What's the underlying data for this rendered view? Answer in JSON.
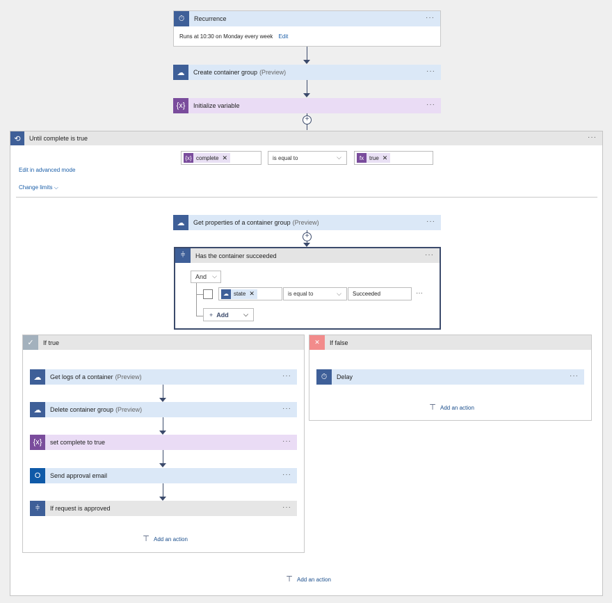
{
  "recurrence": {
    "title": "Recurrence",
    "summary": "Runs at 10:30 on Monday every week",
    "edit": "Edit",
    "icon": "clock-icon"
  },
  "create_group": {
    "title": "Create container group",
    "tag": "(Preview)",
    "icon": "container-cloud-icon"
  },
  "init_var": {
    "title": "Initialize variable",
    "icon": "variable-icon"
  },
  "until": {
    "title": "Until complete is true",
    "left_token": "complete",
    "operator": "is equal to",
    "right_token": "true",
    "advanced_mode": "Edit in advanced mode",
    "change_limits": "Change limits"
  },
  "get_props": {
    "title": "Get properties of a container group",
    "tag": "(Preview)"
  },
  "condition": {
    "title": "Has the container succeeded",
    "group": "And",
    "left_token": "state",
    "operator": "is equal to",
    "value": "Succeeded",
    "add": "Add"
  },
  "if_true": {
    "title": "If true",
    "actions": [
      {
        "title": "Get logs of a container",
        "tag": "(Preview)"
      },
      {
        "title": "Delete container group",
        "tag": "(Preview)"
      },
      {
        "title": "set complete to true",
        "tag": ""
      },
      {
        "title": "Send approval email",
        "tag": ""
      },
      {
        "title": "If request is approved",
        "tag": ""
      }
    ],
    "add_action": "Add an action"
  },
  "if_false": {
    "title": "If false",
    "actions": [
      {
        "title": "Delay"
      }
    ],
    "add_action": "Add an action"
  },
  "bottom_add_action": "Add an action",
  "menu_dots": "···",
  "close_x": "✕",
  "colors": {
    "action_blue": "#dbe8f7",
    "variable_purple": "#eadcf5",
    "icon_blue": "#3e5f98",
    "false_red": "#f28b8b"
  }
}
